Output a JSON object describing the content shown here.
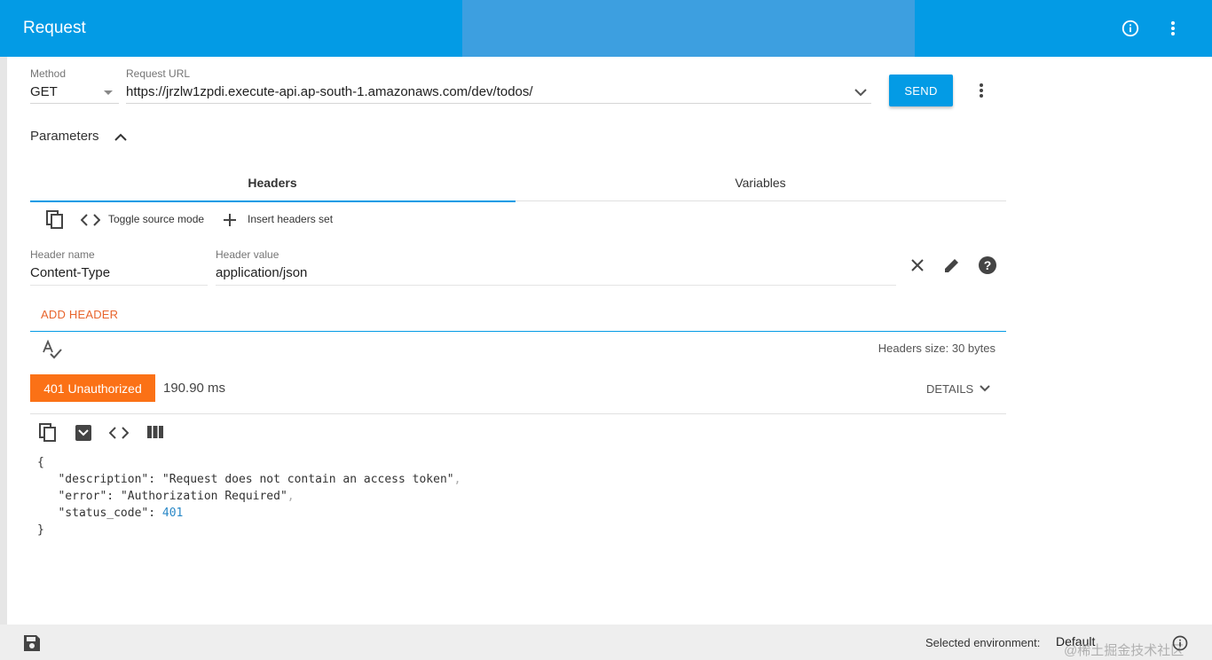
{
  "app_bar": {
    "title": "Request",
    "info_icon": "info-circle-icon",
    "menu_icon": "more-vert-icon"
  },
  "request": {
    "method_label": "Method",
    "method_value": "GET",
    "url_label": "Request URL",
    "url_value": "https://jrzlw1zpdi.execute-api.ap-south-1.amazonaws.com/dev/todos/",
    "send_label": "SEND"
  },
  "parameters": {
    "title": "Parameters",
    "tabs": [
      {
        "label": "Headers",
        "active": true
      },
      {
        "label": "Variables",
        "active": false
      }
    ]
  },
  "headers_toolbar": {
    "toggle_source_label": "Toggle source mode",
    "insert_set_label": "Insert headers set"
  },
  "header_row": {
    "name_label": "Header name",
    "name_value": "Content-Type",
    "value_label": "Header value",
    "value_value": "application/json"
  },
  "add_header_label": "ADD HEADER",
  "headers_size": "Headers size: 30 bytes",
  "response": {
    "status": "401 Unauthorized",
    "time": "190.90 ms",
    "details_label": "DETAILS",
    "body": {
      "description_key": "\"description\"",
      "description_value": "\"Request does not contain an access token\"",
      "error_key": "\"error\"",
      "error_value": "\"Authorization Required\"",
      "status_key": "\"status_code\"",
      "status_value": "401"
    }
  },
  "footer": {
    "env_label": "Selected environment:",
    "env_value": "Default",
    "watermark": "@稀土掘金技术社区"
  },
  "colors": {
    "primary": "#039be5",
    "status_error": "#fb7116",
    "add_header": "#e8642c"
  }
}
